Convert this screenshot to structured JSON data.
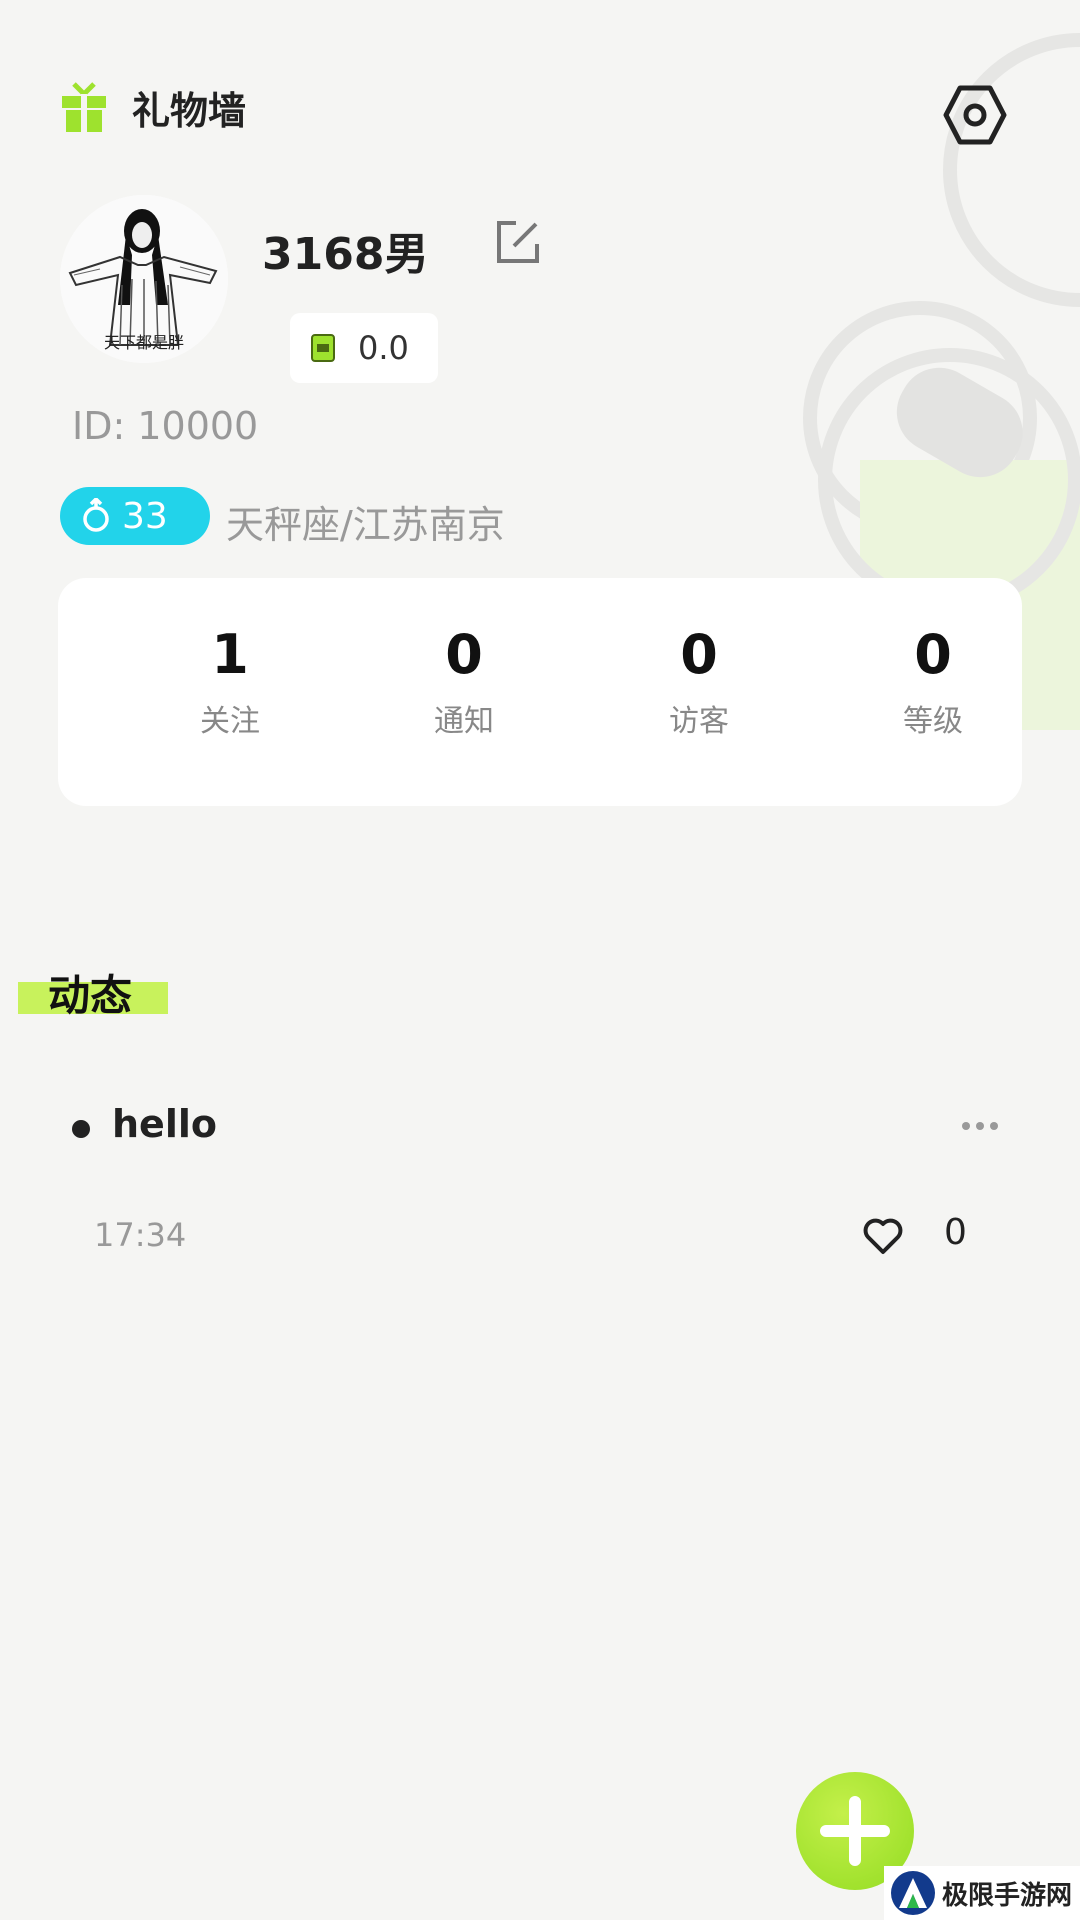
{
  "header": {
    "title": "礼物墙"
  },
  "profile": {
    "avatar_caption": "天下都是胖",
    "username": "3168男",
    "coins": "0.0",
    "id_text": "ID: 10000",
    "age": "33",
    "location": "天秤座/江苏南京"
  },
  "stats": [
    {
      "value": "1",
      "label": "关注"
    },
    {
      "value": "0",
      "label": "通知"
    },
    {
      "value": "0",
      "label": "访客"
    },
    {
      "value": "0",
      "label": "等级"
    }
  ],
  "feed": {
    "section_title": "动态",
    "posts": [
      {
        "text": "hello",
        "time": "17:34",
        "likes": "0"
      }
    ]
  },
  "watermark": {
    "text": "极限手游网"
  },
  "colors": {
    "accent_green": "#9ee22e",
    "age_badge": "#22d3ea",
    "section_highlight": "#c8f25c",
    "background": "#f5f5f3"
  },
  "icons": [
    "gift-icon",
    "settings-icon",
    "edit-icon",
    "coin-icon",
    "male-icon",
    "more-icon",
    "heart-icon",
    "plus-icon"
  ]
}
